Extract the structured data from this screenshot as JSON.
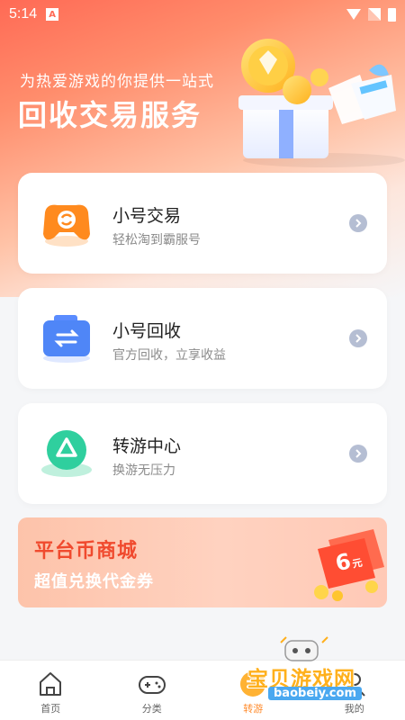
{
  "status_bar": {
    "time": "5:14",
    "notification_letter": "A"
  },
  "hero": {
    "subtitle": "为热爱游戏的你提供一站式",
    "title": "回收交易服务"
  },
  "cards": [
    {
      "title": "小号交易",
      "subtitle": "轻松淘到霸服号",
      "icon": "gamepad-refresh-icon"
    },
    {
      "title": "小号回收",
      "subtitle": "官方回收，立享收益",
      "icon": "swap-bag-icon"
    },
    {
      "title": "转游中心",
      "subtitle": "换游无压力",
      "icon": "triangle-recycle-icon"
    }
  ],
  "banner": {
    "title": "平台币商城",
    "subtitle": "超值兑换代金券",
    "coupon_value": "6",
    "coupon_unit": "元"
  },
  "tabbar": [
    {
      "label": "首页",
      "icon": "home-icon",
      "active": false
    },
    {
      "label": "分类",
      "icon": "gamepad-icon",
      "active": false
    },
    {
      "label": "转游",
      "icon": "transfer-icon",
      "active": true
    },
    {
      "label": "我的",
      "icon": "profile-icon",
      "active": false
    }
  ],
  "watermark": {
    "text": "宝贝游戏网",
    "url": "baobeiy.com"
  },
  "colors": {
    "accent": "#ff8a2a",
    "hero_red": "#ff6a55",
    "banner_red": "#f04a2e"
  }
}
